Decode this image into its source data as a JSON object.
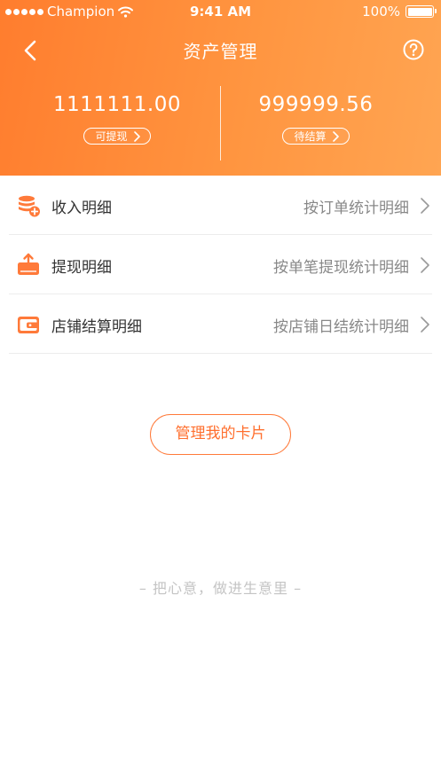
{
  "status_bar": {
    "carrier": "Champion",
    "time": "9:41 AM",
    "battery": "100%"
  },
  "nav": {
    "title": "资产管理"
  },
  "balances": [
    {
      "amount": "1111111.00",
      "label": "可提现"
    },
    {
      "amount": "999999.56",
      "label": "待结算"
    }
  ],
  "rows": [
    {
      "label": "收入明细",
      "desc": "按订单统计明细",
      "icon": "coin-stack-add-icon"
    },
    {
      "label": "提现明细",
      "desc": "按单笔提现统计明细",
      "icon": "withdraw-upload-icon"
    },
    {
      "label": "店铺结算明细",
      "desc": "按店铺日结统计明细",
      "icon": "wallet-icon"
    }
  ],
  "manage_button": "管理我的卡片",
  "slogan": "– 把心意，做进生意里 –",
  "colors": {
    "header_start": "#ff7d2e",
    "header_end": "#ffa552",
    "accent": "#ff7a3a",
    "icon": "#ff7a3a"
  }
}
